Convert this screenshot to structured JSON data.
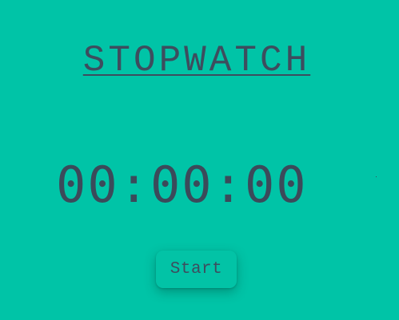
{
  "app": {
    "title": "STOPWATCH"
  },
  "display": {
    "time": "00:00:00"
  },
  "controls": {
    "start_label": "Start"
  },
  "colors": {
    "background": "#00c4a7",
    "text": "#3b4a5a",
    "button_bg": "#02c3a6"
  }
}
